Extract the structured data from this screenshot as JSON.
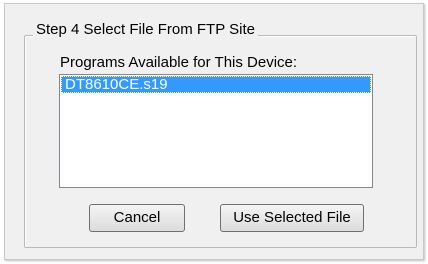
{
  "groupbox": {
    "title": "Step 4 Select File From FTP Site"
  },
  "programs": {
    "label": "Programs Available for This Device:",
    "items": [
      {
        "name": "DT8610CE.s19",
        "selected": true
      }
    ]
  },
  "buttons": {
    "cancel_label": "Cancel",
    "use_selected_label": "Use Selected File"
  },
  "colors": {
    "selection": "#3399ff",
    "dialog_bg": "#f0f0f0"
  }
}
